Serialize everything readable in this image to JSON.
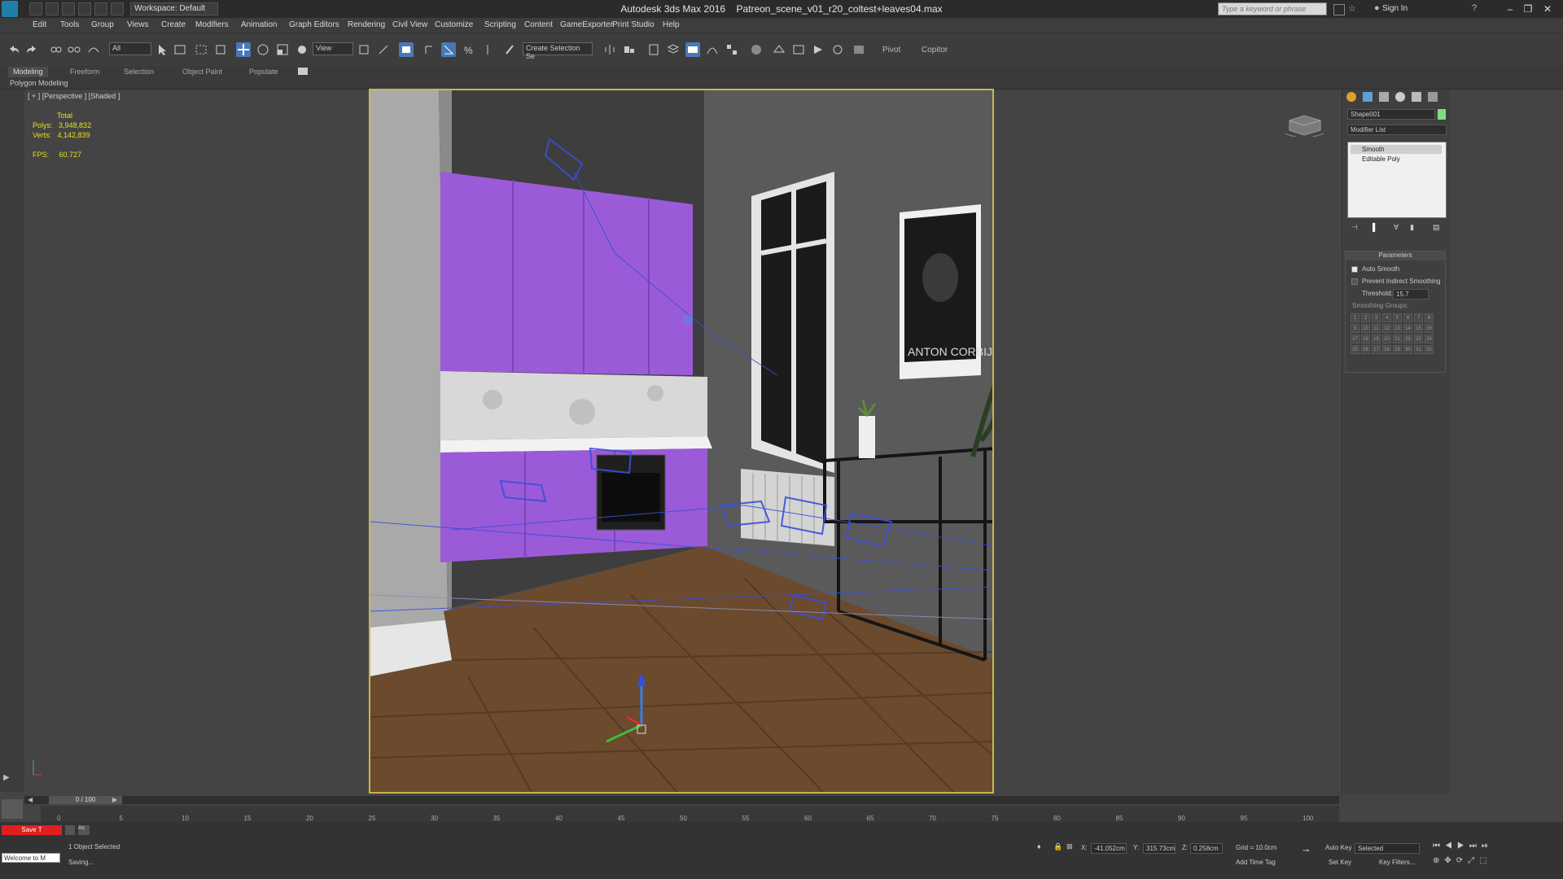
{
  "window": {
    "title": "Autodesk 3ds Max 2016",
    "filename": "Patreon_scene_v01_r20_coltest+leaves04.max",
    "workspace": "Workspace: Default",
    "search_placeholder": "Type a keyword or phrase",
    "signin": "Sign In"
  },
  "menu": [
    "Edit",
    "Tools",
    "Group",
    "Views",
    "Create",
    "Modifiers",
    "Animation",
    "Graph Editors",
    "Rendering",
    "Civil View",
    "Customize",
    "Scripting",
    "Content",
    "GameExporter",
    "Print Studio",
    "Help"
  ],
  "toolbar": {
    "selection_filter": "All",
    "ref_coord": "View",
    "named_selection": "Create Selection Se",
    "pivot_label": "Pivot",
    "copitor_label": "Copitor"
  },
  "ribbon": {
    "tabs": [
      "Modeling",
      "Freeform",
      "Selection",
      "Object Paint",
      "Populate"
    ],
    "active_tab": "Modeling",
    "sub_label": "Polygon Modeling"
  },
  "viewport": {
    "label": "[ + ] [Perspective ] [Shaded ]",
    "stats": {
      "total_label": "Total",
      "polys_label": "Polys:",
      "polys": "3,948,832",
      "verts_label": "Verts:",
      "verts": "4,142,839",
      "fps_label": "FPS:",
      "fps": "60.727"
    },
    "poster_text": "ANTON CORBIJN",
    "colors": {
      "cabinet": "#9b5bd8",
      "wall": "#555555",
      "floor": "#6b4a2d",
      "wire": "#3a4fd8",
      "frame": "#c9b84a"
    }
  },
  "command_panel": {
    "object_name": "Shape001",
    "modifier_list": "Modifier List",
    "stack": [
      "Smooth",
      "Editable Poly"
    ],
    "rollout_title": "Parameters",
    "auto_smooth": "Auto Smooth",
    "prevent_indirect": "Prevent Indirect Smoothing",
    "threshold_label": "Threshold:",
    "threshold_value": "15.7",
    "smoothing_groups_label": "Smoothing Groups:",
    "smoothing_groups": [
      "1",
      "2",
      "3",
      "4",
      "5",
      "6",
      "7",
      "8",
      "9",
      "10",
      "11",
      "12",
      "13",
      "14",
      "15",
      "16",
      "17",
      "18",
      "19",
      "20",
      "21",
      "22",
      "23",
      "24",
      "25",
      "26",
      "27",
      "28",
      "29",
      "30",
      "31",
      "32"
    ]
  },
  "timeline": {
    "slider_label": "0 / 100",
    "ticks": [
      "0",
      "5",
      "10",
      "15",
      "20",
      "25",
      "30",
      "35",
      "40",
      "45",
      "50",
      "55",
      "60",
      "65",
      "70",
      "75",
      "80",
      "85",
      "90",
      "95",
      "100"
    ]
  },
  "status": {
    "maxscript": "Welcome to M",
    "red_label": "Save T",
    "selection_status": "1 Object Selected",
    "prompt": "Saving...",
    "x_label": "X:",
    "x": "-41.052cm",
    "y_label": "Y:",
    "y": "315.73cm",
    "z_label": "Z:",
    "z": "0.258cm",
    "grid": "Grid = 10.0cm",
    "add_time_tag": "Add Time Tag",
    "auto_key": "Auto Key",
    "set_key": "Set Key",
    "selected_dropdown": "Selected",
    "key_filters": "Key Filters..."
  }
}
